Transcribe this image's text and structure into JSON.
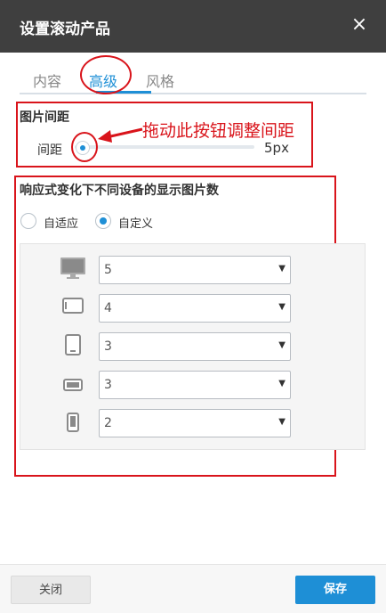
{
  "dialog": {
    "title": "设置滚动产品",
    "close_glyph": "×"
  },
  "tabs": [
    {
      "label": "内容",
      "active": false
    },
    {
      "label": "高级",
      "active": true
    },
    {
      "label": "风格",
      "active": false
    }
  ],
  "spacing": {
    "section_title": "图片间距",
    "label": "间距",
    "value_text": "5px",
    "value_fraction": 0.0
  },
  "annotation": {
    "text": "拖动此按钮调整间距",
    "color": "#d9141b"
  },
  "responsive": {
    "section_title": "响应式变化下不同设备的显示图片数",
    "radios": [
      {
        "label": "自适应",
        "checked": false
      },
      {
        "label": "自定义",
        "checked": true
      }
    ],
    "devices": [
      {
        "icon": "desktop-icon",
        "value": "5"
      },
      {
        "icon": "tablet-landscape-icon",
        "value": "4"
      },
      {
        "icon": "tablet-portrait-icon",
        "value": "3"
      },
      {
        "icon": "phone-landscape-icon",
        "value": "3"
      },
      {
        "icon": "phone-portrait-icon",
        "value": "2"
      }
    ]
  },
  "footer": {
    "close_label": "关闭",
    "save_label": "保存"
  },
  "colors": {
    "accent": "#1e8fd6",
    "titlebar": "#3f3f3f",
    "annotation_red": "#d9141b"
  }
}
